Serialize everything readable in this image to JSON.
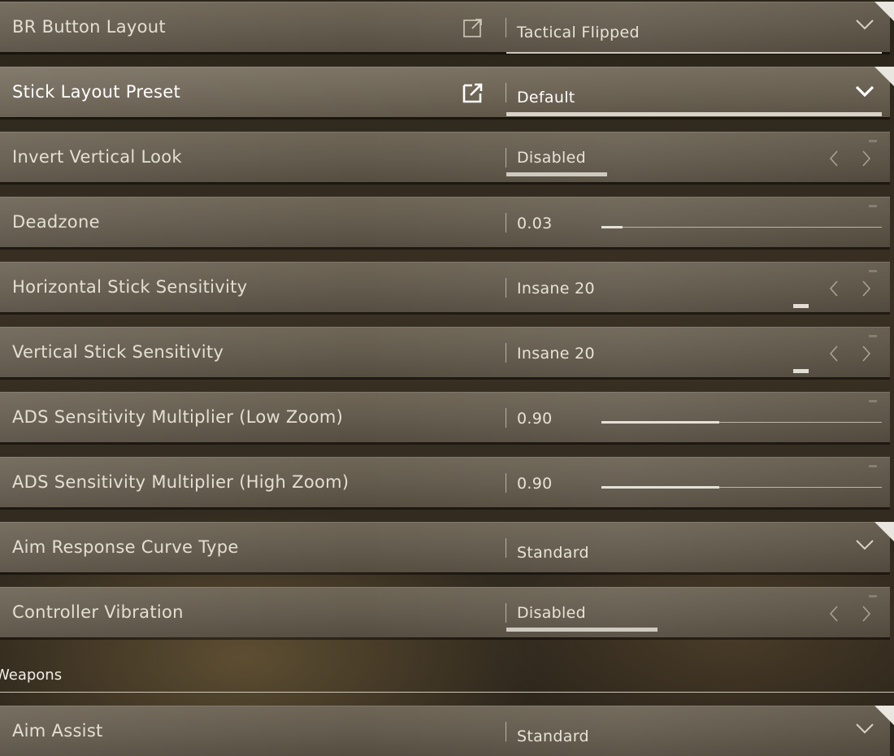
{
  "rows": [
    {
      "label": "BR Button Layout",
      "value": "Tactical Flipped",
      "control": "dropdown-link"
    },
    {
      "label": "Stick Layout Preset",
      "value": "Default",
      "control": "dropdown-link"
    },
    {
      "label": "Invert Vertical Look",
      "value": "Disabled",
      "control": "selector"
    },
    {
      "label": "Deadzone",
      "value": "0.03",
      "control": "slider",
      "level": 0.075
    },
    {
      "label": "Horizontal Stick Sensitivity",
      "value": "Insane 20",
      "control": "selector"
    },
    {
      "label": "Vertical Stick Sensitivity",
      "value": "Insane 20",
      "control": "selector"
    },
    {
      "label": "ADS Sensitivity Multiplier (Low Zoom)",
      "value": "0.90",
      "control": "slider",
      "level": 0.42
    },
    {
      "label": "ADS Sensitivity Multiplier (High Zoom)",
      "value": "0.90",
      "control": "slider",
      "level": 0.42
    },
    {
      "label": "Aim Response Curve Type",
      "value": "Standard",
      "control": "dropdown"
    },
    {
      "label": "Controller Vibration",
      "value": "Disabled",
      "control": "selector"
    }
  ],
  "section": {
    "title": "Weapons"
  },
  "weapons_rows": [
    {
      "label": "Aim Assist",
      "value": "Standard",
      "control": "dropdown"
    }
  ],
  "colors": {
    "panel": "#625a4c",
    "text": "#e4dfd2",
    "accent": "#d8d3c8"
  },
  "icons": {
    "link": "external-link-icon",
    "dropdown": "chevron-down-icon",
    "prev": "chevron-left-icon",
    "next": "chevron-right-icon"
  }
}
